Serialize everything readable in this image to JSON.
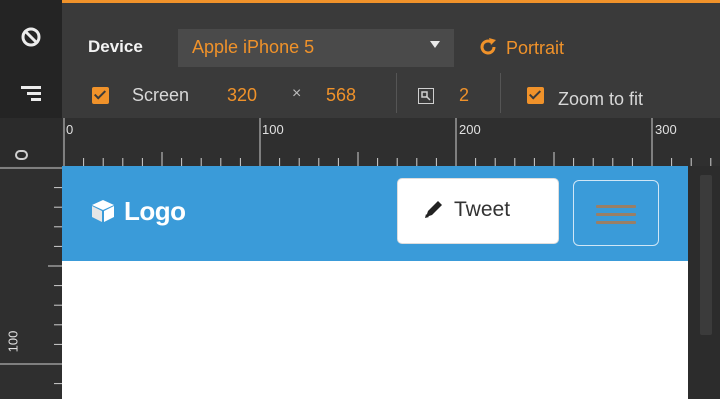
{
  "toolbar": {
    "device_label": "Device",
    "device_value": "Apple iPhone 5",
    "orientation_label": "Portrait",
    "screen_label": "Screen",
    "screen_width": "320",
    "times_sign": "×",
    "screen_height": "568",
    "pixel_ratio": "2",
    "zoom_label": "Zoom to fit"
  },
  "ruler": {
    "top_labels": [
      "0",
      "100",
      "200",
      "300"
    ],
    "left_labels": [
      "100"
    ]
  },
  "page": {
    "logo_text": "Logo",
    "tweet_label": "Tweet"
  },
  "icons": {
    "no_entry": "no-entry-icon",
    "media_queries": "media-queries-icon",
    "ruler_toggle": "ruler-toggle-icon",
    "rotate": "rotate-icon",
    "pixel_ratio": "pixel-ratio-icon",
    "logo": "cube-icon",
    "tweet": "pencil-icon",
    "menu": "hamburger-icon"
  },
  "colors": {
    "accent": "#f0922a",
    "navbar": "#3a9bd9"
  }
}
